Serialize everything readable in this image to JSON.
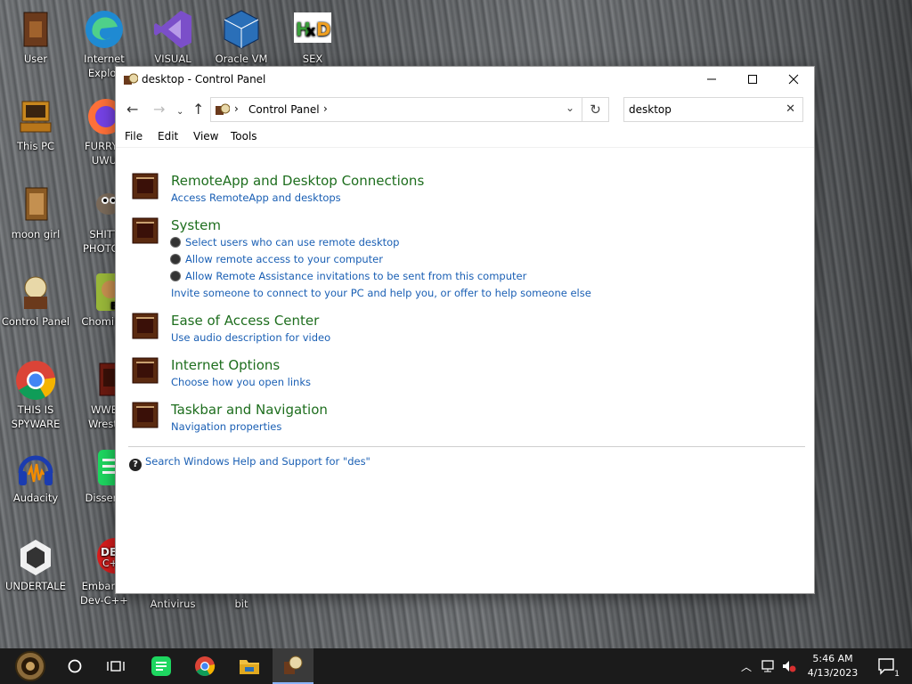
{
  "desktop": {
    "icons": [
      {
        "label": "User"
      },
      {
        "label": "Internet\nExplor"
      },
      {
        "label": "VISUAL"
      },
      {
        "label": "Oracle VM"
      },
      {
        "label": "SEX"
      },
      {
        "label": "This PC"
      },
      {
        "label": "FURRYF\nUWU"
      },
      {
        "label": "moon girl"
      },
      {
        "label": "SHITT\nPHOTOS"
      },
      {
        "label": "Control Panel"
      },
      {
        "label": "ChomikB"
      },
      {
        "label": "THIS IS\nSPYWARE"
      },
      {
        "label": "WWE\nWrestl"
      },
      {
        "label": "Audacity"
      },
      {
        "label": "Dissent"
      },
      {
        "label": "UNDERTALE"
      },
      {
        "label": "Embarca\nDev-C++"
      },
      {
        "label": "Antivirus"
      },
      {
        "label": "bit"
      }
    ]
  },
  "window": {
    "title": "desktop - Control Panel",
    "address": {
      "crumb": "Control Panel"
    },
    "search": {
      "value": "desktop"
    },
    "menu": [
      "File",
      "Edit",
      "View",
      "Tools"
    ],
    "results": [
      {
        "title": "RemoteApp and Desktop Connections",
        "links": [
          "Access RemoteApp and desktops"
        ]
      },
      {
        "title": "System",
        "shielded_links": [
          "Select users who can use remote desktop",
          "Allow remote access to your computer",
          "Allow Remote Assistance invitations to be sent from this computer"
        ],
        "links": [
          "Invite someone to connect to your PC and help you, or offer to help someone else"
        ]
      },
      {
        "title": "Ease of Access Center",
        "links": [
          "Use audio description for video"
        ]
      },
      {
        "title": "Internet Options",
        "links": [
          "Choose how you open links"
        ]
      },
      {
        "title": "Taskbar and Navigation",
        "links": [
          "Navigation properties"
        ]
      }
    ],
    "help_link": "Search Windows Help and Support for \"des\""
  },
  "taskbar": {
    "time": "5:46 AM",
    "date": "4/13/2023",
    "notification_count": "1"
  },
  "colors": {
    "result_title": "#1e6e1e",
    "link": "#1a5fb4",
    "taskbar": "#1b1b1b"
  }
}
